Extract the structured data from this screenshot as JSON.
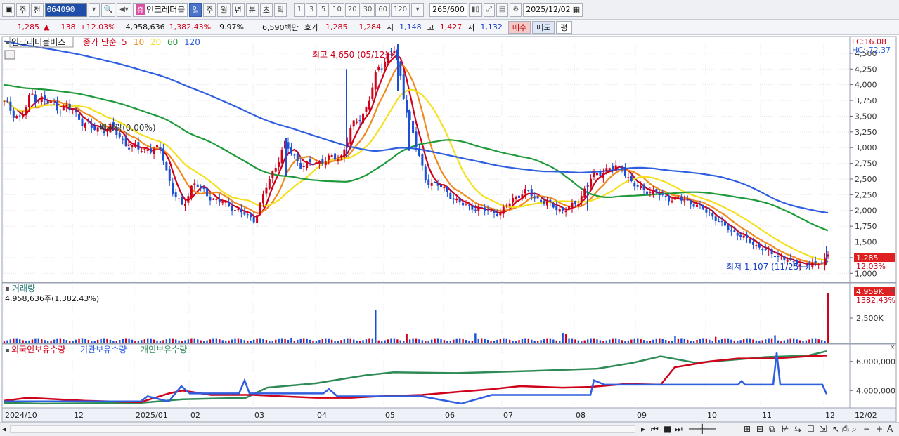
{
  "toolbar": {
    "market": "주",
    "prev": "전",
    "code": "064090",
    "stock_tag": "증",
    "stock_name": "인크레더블",
    "periods": [
      "일",
      "주",
      "월",
      "년",
      "분",
      "초",
      "틱"
    ],
    "active_period": "일",
    "intervals": [
      "1",
      "3",
      "5",
      "10",
      "20",
      "30",
      "60",
      "120"
    ],
    "count": "265",
    "count_total": "/600",
    "date": "2025/12/02"
  },
  "quote": {
    "price": "1,285",
    "change_arrow": "▲",
    "change": "138",
    "change_pct": "+12.03%",
    "volume": "4,958,636",
    "volume_pct": "1,382.43%",
    "turnover_pct": "9.97%",
    "amount": "6,590백만",
    "ask_label": "호가",
    "ask1": "1,285",
    "ask2": "1,284",
    "open_label": "시",
    "open": "1,148",
    "high_label": "고",
    "high": "1,427",
    "low_label": "저",
    "low": "1,132",
    "buy_label": "매수",
    "sell_label": "매도",
    "eval_label": "평"
  },
  "price_panel": {
    "legend_name": "인크레더블버즈",
    "legend_ma_title": "종가 단순",
    "ma_labels": [
      "5",
      "10",
      "20",
      "60",
      "120"
    ],
    "ma_colors": [
      "#d0021b",
      "#f08a1c",
      "#f5e020",
      "#1f9a3a",
      "#2f5fe0"
    ],
    "lc": "LC:16.08",
    "hc": "HC:-72.37",
    "high_note": "최고 4,650 (05/12)",
    "low_note": "최저 1,107 (11/25)",
    "dividend_note": "배당락(0.00%)",
    "last_price": "1,285",
    "last_pct": "12.03%",
    "y_ticks": [
      "4,500",
      "4,250",
      "4,000",
      "3,750",
      "3,500",
      "3,250",
      "3,000",
      "2,750",
      "2,500",
      "2,250",
      "2,000",
      "1,750",
      "1,500",
      "1,250",
      "1,000"
    ]
  },
  "volume_panel": {
    "title": "거래량",
    "subtitle": "4,958,636주(1,382.43%)",
    "last_label": "4,959K",
    "last_pct": "1382.43%",
    "y_tick": "2,500K"
  },
  "holding_panel": {
    "legend": [
      "외국인보유수량",
      "기관보유수량",
      "개인보유수량"
    ],
    "legend_colors": [
      "#d0021b",
      "#2f5fe0",
      "#2e8b57"
    ],
    "y_ticks": [
      "6,000,000",
      "4,000,000"
    ]
  },
  "x_axis": [
    "2024/10",
    "12",
    "2025/01",
    "02",
    "03",
    "04",
    "05",
    "06",
    "07",
    "08",
    "09",
    "10",
    "11",
    "12",
    "12/02"
  ],
  "chart_data": {
    "type": "line",
    "title": "인크레더블버즈",
    "price_ylim": [
      1000,
      4650
    ],
    "ma": [
      {
        "name": "5",
        "color": "#d0021b"
      },
      {
        "name": "10",
        "color": "#f08a1c"
      },
      {
        "name": "20",
        "color": "#f5e020"
      },
      {
        "name": "60",
        "color": "#1f9a3a"
      },
      {
        "name": "120",
        "color": "#2f5fe0"
      }
    ],
    "close_path": [
      {
        "t": "2024/10",
        "v": 3700
      },
      {
        "t": "2024/11",
        "v": 3650
      },
      {
        "t": "2024/12",
        "v": 3400
      },
      {
        "t": "2025/01",
        "v": 2950
      },
      {
        "t": "2025/02",
        "v": 2300
      },
      {
        "t": "2025/03",
        "v": 1850
      },
      {
        "t": "2025/04",
        "v": 2900
      },
      {
        "t": "2025/05",
        "v": 4600
      },
      {
        "t": "2025/06",
        "v": 2400
      },
      {
        "t": "2025/07",
        "v": 2000
      },
      {
        "t": "2025/08",
        "v": 2050
      },
      {
        "t": "2025/09",
        "v": 2250
      },
      {
        "t": "2025/10",
        "v": 1850
      },
      {
        "t": "2025/11",
        "v": 1200
      },
      {
        "t": "2025/12/02",
        "v": 1285
      }
    ],
    "high": {
      "date": "05/12",
      "value": 4650
    },
    "low": {
      "date": "11/25",
      "value": 1107
    },
    "volume_ylim": [
      0,
      5000000
    ],
    "holding_ylim": [
      3000000,
      7000000
    ]
  }
}
